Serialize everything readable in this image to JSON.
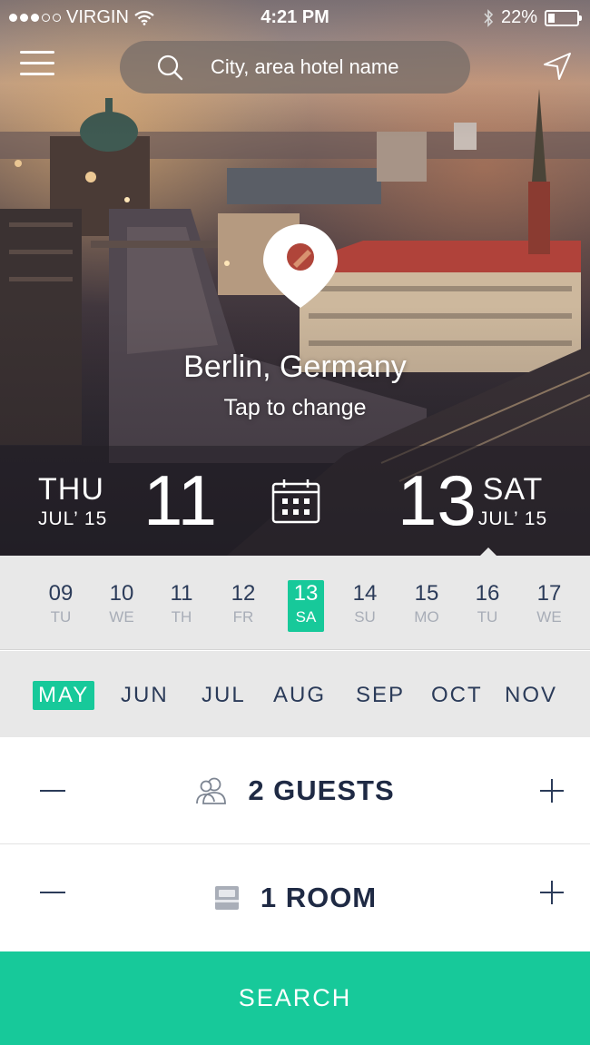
{
  "status_bar": {
    "carrier": "VIRGIN",
    "time": "4:21 PM",
    "battery": "22%",
    "battery_level": 0.22,
    "icons": [
      "signal-dots",
      "wifi-icon",
      "bluetooth-icon",
      "battery-icon"
    ]
  },
  "header": {
    "menu_icon": "hamburger-menu-icon",
    "search": {
      "placeholder": "City, area hotel name",
      "icon": "search-icon"
    },
    "location_icon": "navigation-arrow-icon"
  },
  "location": {
    "pin_icon": "map-pin-icon",
    "city": "Berlin, Germany",
    "hint": "Tap to change"
  },
  "dates": {
    "check_in": {
      "weekday": "THU",
      "month_year": "JUL’ 15",
      "day": "11"
    },
    "calendar_icon": "calendar-icon",
    "check_out": {
      "weekday": "SAT",
      "month_year": "JUL’ 15",
      "day": "13"
    }
  },
  "day_strip": [
    {
      "num": "09",
      "dow": "TU"
    },
    {
      "num": "10",
      "dow": "WE"
    },
    {
      "num": "11",
      "dow": "TH"
    },
    {
      "num": "12",
      "dow": "FR"
    },
    {
      "num": "13",
      "dow": "SA",
      "selected": true
    },
    {
      "num": "14",
      "dow": "SU"
    },
    {
      "num": "15",
      "dow": "MO"
    },
    {
      "num": "16",
      "dow": "TU"
    },
    {
      "num": "17",
      "dow": "WE"
    }
  ],
  "month_strip": [
    {
      "label": "MAY",
      "selected": true
    },
    {
      "label": "JUN"
    },
    {
      "label": "JUL"
    },
    {
      "label": "AUG"
    },
    {
      "label": "SEP"
    },
    {
      "label": "OCT"
    },
    {
      "label": "NOV"
    }
  ],
  "guests": {
    "label": "2 GUESTS",
    "icon": "guests-icon"
  },
  "rooms": {
    "label": "1 ROOM",
    "icon": "bed-icon"
  },
  "actions": {
    "search_label": "SEARCH"
  },
  "colors": {
    "accent": "#17c99a",
    "text_dark": "#1f2a44",
    "strip_bg": "#e8e8e8"
  }
}
